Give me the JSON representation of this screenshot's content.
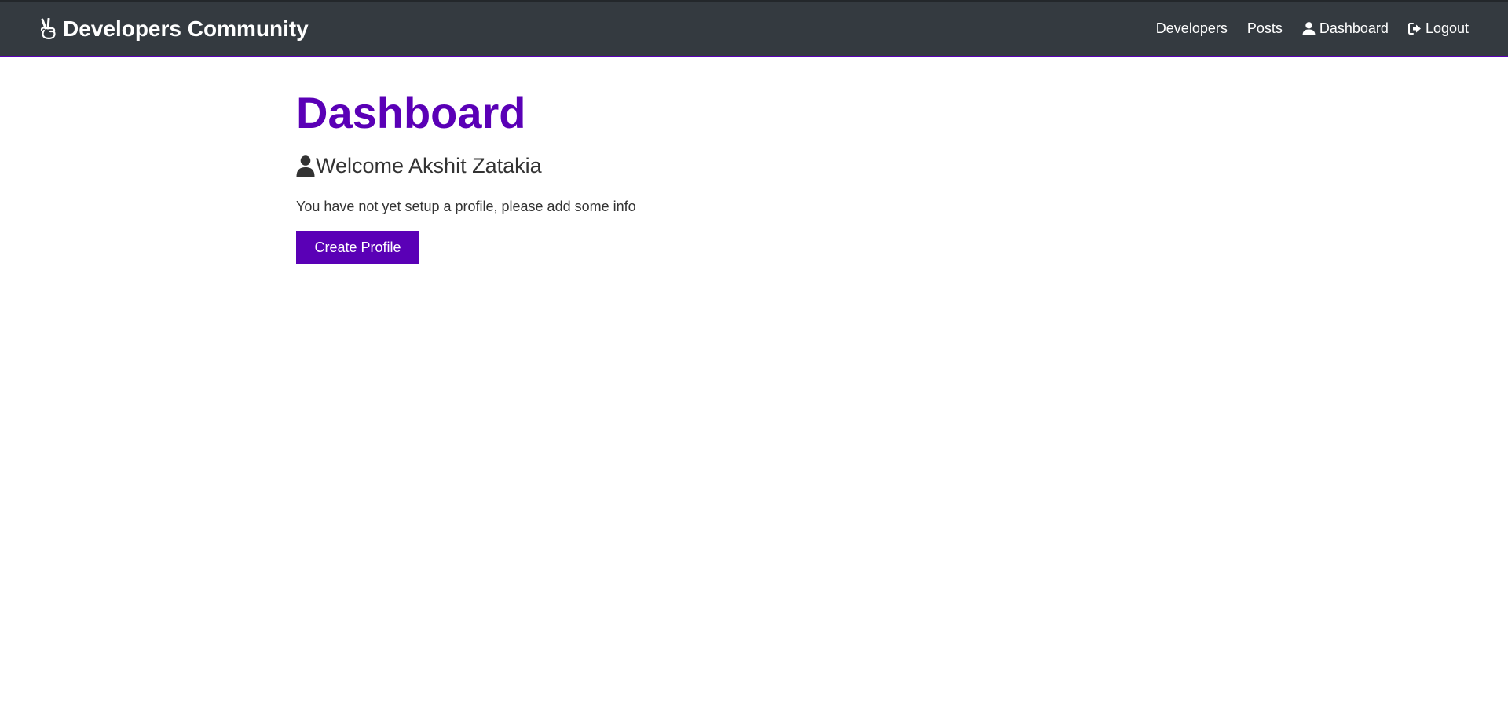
{
  "navbar": {
    "brand_icon": "peace-hand-icon",
    "brand_title": "Developers Community",
    "links": {
      "developers": "Developers",
      "posts": "Posts",
      "dashboard": "Dashboard",
      "logout": "Logout"
    },
    "background_color": "#343a40",
    "accent_color": "#5a00b6"
  },
  "main": {
    "title": "Dashboard",
    "welcome": "Welcome Akshit Zatakia",
    "welcome_icon": "user-icon",
    "info_text": "You have not yet setup a profile, please add some info",
    "create_profile_label": "Create Profile"
  }
}
